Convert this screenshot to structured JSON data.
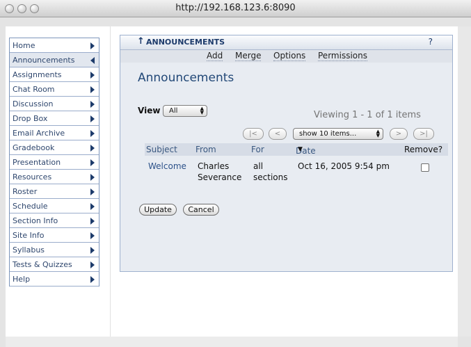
{
  "window": {
    "title": "http://192.168.123.6:8090"
  },
  "sidebar": {
    "items": [
      {
        "label": "Home"
      },
      {
        "label": "Announcements",
        "active": true
      },
      {
        "label": "Assignments"
      },
      {
        "label": "Chat Room"
      },
      {
        "label": "Discussion"
      },
      {
        "label": "Drop Box"
      },
      {
        "label": "Email Archive"
      },
      {
        "label": "Gradebook"
      },
      {
        "label": "Presentation"
      },
      {
        "label": "Resources"
      },
      {
        "label": "Roster"
      },
      {
        "label": "Schedule"
      },
      {
        "label": "Section Info"
      },
      {
        "label": "Site Info"
      },
      {
        "label": "Syllabus"
      },
      {
        "label": "Tests & Quizzes"
      },
      {
        "label": "Help"
      }
    ]
  },
  "portlet": {
    "title": "ANNOUNCEMENTS",
    "help": "?",
    "toolbar": {
      "add": "Add",
      "merge": "Merge",
      "options": "Options",
      "permissions": "Permissions"
    },
    "page_title": "Announcements",
    "view_label": "View",
    "view_select": "All",
    "viewing_text": "Viewing 1 - 1 of 1 items",
    "pager": {
      "first": "|<",
      "prev": "<",
      "page_size": "show 10 items...",
      "next": ">",
      "last": ">|"
    },
    "table": {
      "headers": {
        "subject": "Subject",
        "from": "From",
        "for": "For",
        "date": "Date",
        "remove": "Remove?"
      },
      "rows": [
        {
          "subject": "Welcome",
          "from_line1": "Charles",
          "from_line2": "Severance",
          "for_line1": "all",
          "for_line2": "sections",
          "date": "Oct 16, 2005 9:54 pm"
        }
      ]
    },
    "buttons": {
      "update": "Update",
      "cancel": "Cancel"
    }
  },
  "colors": {
    "accent": "#224877",
    "link": "#2c5189",
    "table_header_bg": "#d6dce6",
    "portlet_bg": "#e8ecf2"
  }
}
